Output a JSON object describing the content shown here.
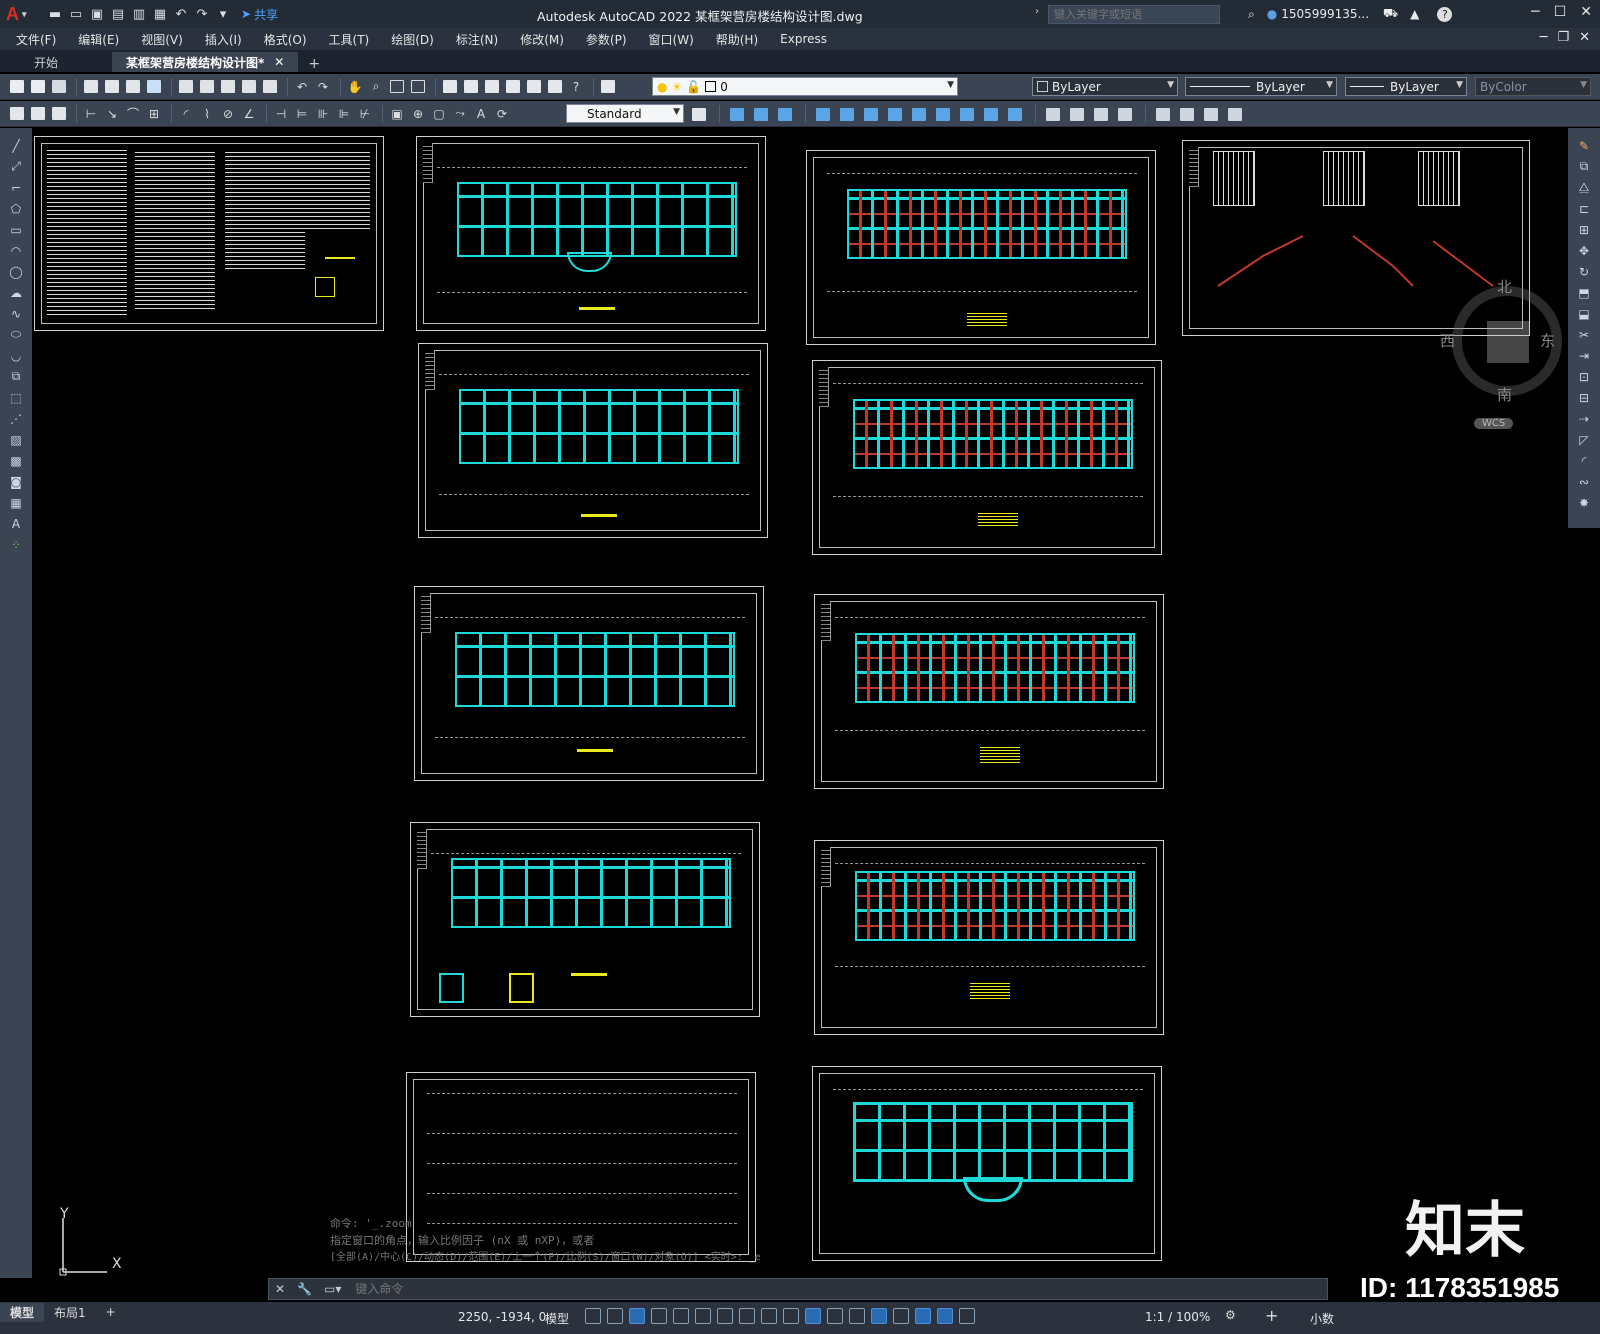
{
  "titlebar": {
    "logo": "A",
    "share_label": "共享",
    "title": "Autodesk AutoCAD 2022    某框架营房楼结构设计图.dwg",
    "search_placeholder": "键入关键字或短语",
    "user": "1505999135...",
    "help": "?"
  },
  "menu": [
    "文件(F)",
    "编辑(E)",
    "视图(V)",
    "插入(I)",
    "格式(O)",
    "工具(T)",
    "绘图(D)",
    "标注(N)",
    "修改(M)",
    "参数(P)",
    "窗口(W)",
    "帮助(H)",
    "Express"
  ],
  "doc_tabs": {
    "start": "开始",
    "active": "某框架营房楼结构设计图*"
  },
  "toolbar": {
    "layer_value": "0",
    "color": "ByLayer",
    "linetype": "ByLayer",
    "lineweight": "ByLayer",
    "plotstyle": "ByColor",
    "textstyle": "Standard"
  },
  "viewcube": {
    "north": "北",
    "south": "南",
    "east": "东",
    "west": "西",
    "wcs": "WCS"
  },
  "ucs": {
    "x": "X",
    "y": "Y"
  },
  "command": {
    "history": [
      "命令: '_.zoom",
      "指定窗口的角点，输入比例因子 (nX 或 nXP)，或者",
      "[全部(A)/中心(C)/动态(D)/范围(E)/上一个(P)/比例(S)/窗口(W)/对象(O)] <实时>: _e"
    ],
    "placeholder": "键入命令"
  },
  "layout_tabs": {
    "model": "模型",
    "layout1": "布局1",
    "add": "+"
  },
  "status": {
    "coords": "2250, -1934, 0",
    "model": "模型",
    "scale": "1:1 / 100%",
    "units": "小数"
  },
  "brand": {
    "name": "知末",
    "id": "ID: 1178351985"
  },
  "colors": {
    "grid": "#1fd9d9",
    "rebar": "#c0392b",
    "text": "#e8e81a",
    "ui_bg": "#3b4453"
  }
}
